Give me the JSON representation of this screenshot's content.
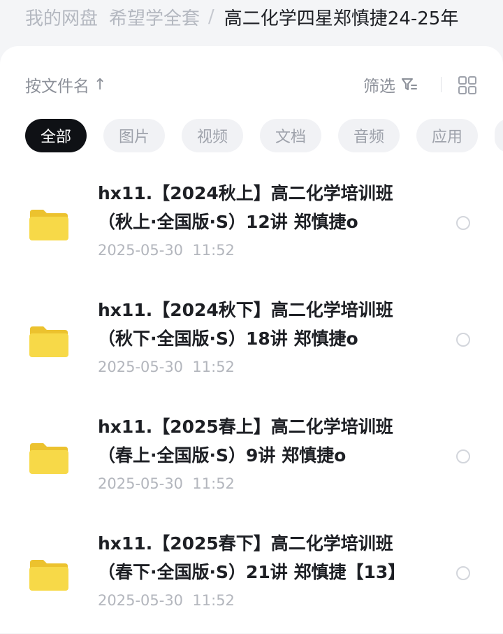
{
  "breadcrumb": {
    "items": [
      "我的网盘",
      "希望学全套"
    ],
    "separator": "/",
    "current": "高二化学四星郑慎捷24-25年"
  },
  "toolbar": {
    "sort_label": "按文件名",
    "sort_arrow": "↑",
    "filter_label": "筛选",
    "filter_icon": "filter-icon",
    "view_icon": "grid-view-icon"
  },
  "tabs": [
    {
      "label": "全部",
      "active": true
    },
    {
      "label": "图片",
      "active": false
    },
    {
      "label": "视频",
      "active": false
    },
    {
      "label": "文档",
      "active": false
    },
    {
      "label": "音频",
      "active": false
    },
    {
      "label": "应用",
      "active": false
    }
  ],
  "files": [
    {
      "name": "hx11.【2024秋上】高二化学培训班\n（秋上·全国版·S）12讲 郑慎捷o",
      "date": "2025-05-30  11:52",
      "icon": "folder-icon"
    },
    {
      "name": "hx11.【2024秋下】高二化学培训班\n（秋下·全国版·S）18讲 郑慎捷o",
      "date": "2025-05-30  11:52",
      "icon": "folder-icon"
    },
    {
      "name": "hx11.【2025春上】高二化学培训班\n（春上·全国版·S）9讲 郑慎捷o",
      "date": "2025-05-30  11:52",
      "icon": "folder-icon"
    },
    {
      "name": "hx11.【2025春下】高二化学培训班\n（春下·全国版·S）21讲 郑慎捷【13】",
      "date": "2025-05-30  11:52",
      "icon": "folder-icon"
    }
  ],
  "colors": {
    "background": "#f4f5f7",
    "card": "#ffffff",
    "active_tab": "#0f1115",
    "folder": "#f5d440",
    "muted_text": "#b3b6bd"
  }
}
